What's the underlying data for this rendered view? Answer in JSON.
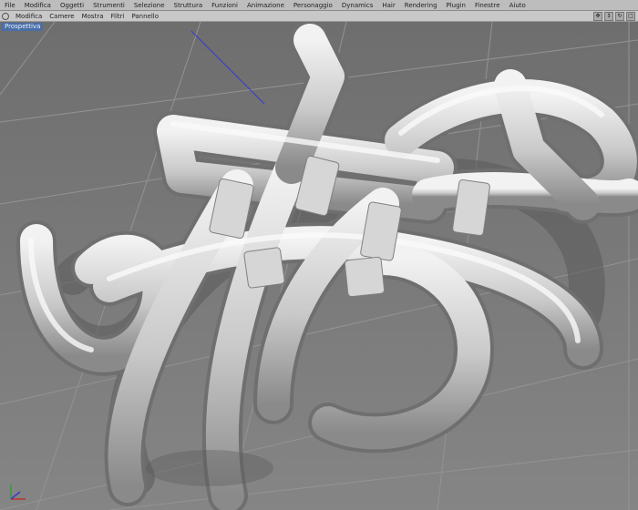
{
  "menu": [
    "File",
    "Modifica",
    "Oggetti",
    "Strumenti",
    "Selezione",
    "Struttura",
    "Funzioni",
    "Animazione",
    "Personaggio",
    "Dynamics",
    "Hair",
    "Rendering",
    "Plugin",
    "Finestre",
    "Aiuto"
  ],
  "viewport_menu": [
    "Modifica",
    "Camere",
    "Mostra",
    "Filtri",
    "Pannello"
  ],
  "viewport_label": "Prospettiva",
  "colors": {
    "background": "#7d7d7d",
    "grid": "#8e8e8e",
    "model": "#d9d9d9",
    "label_bg": "#4a6fa8"
  }
}
